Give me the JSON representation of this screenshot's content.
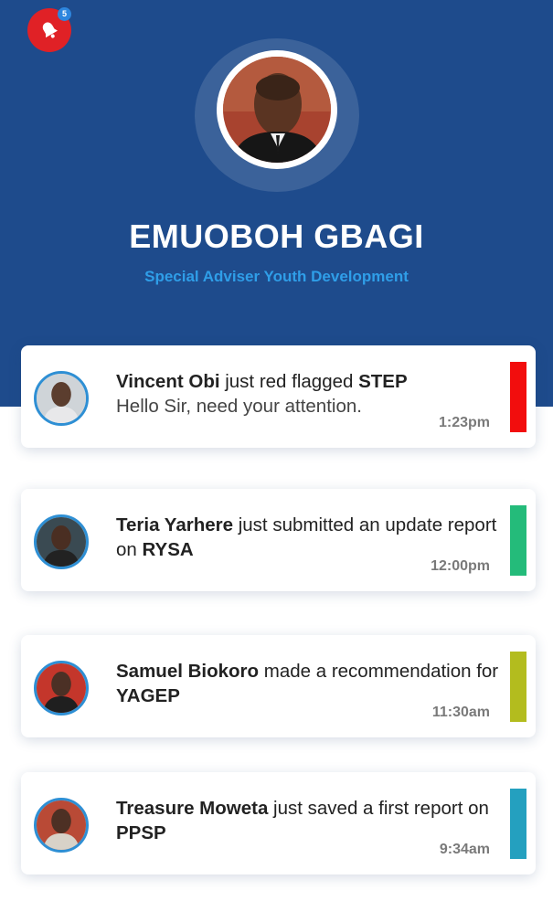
{
  "notifications_count": "5",
  "profile": {
    "name": "EMUOBOH GBAGI",
    "role": "Special Adviser Youth Development"
  },
  "feed": [
    {
      "actor": "Vincent Obi",
      "action": " just red flagged ",
      "project": "STEP",
      "message": "Hello Sir, need your attention.",
      "time": "1:23pm",
      "status_color": "#f20d0d"
    },
    {
      "actor": "Teria Yarhere",
      "action": " just submitted an update report on ",
      "project": "RYSA",
      "time": "12:00pm",
      "status_color": "#24bb7a"
    },
    {
      "actor": "Samuel Biokoro",
      "action": " made a recommendation for ",
      "project": "YAGEP",
      "time": "11:30am",
      "status_color": "#b3bc1e"
    },
    {
      "actor": "Treasure Moweta",
      "action": " just saved a first report on ",
      "project": "PPSP",
      "time": "9:34am",
      "status_color": "#24a0bf"
    }
  ],
  "colors": {
    "header_bg": "#1e4b8c",
    "role_text": "#2f9ee8",
    "bell_bg": "#e02126",
    "badge_bg": "#2e86de"
  }
}
